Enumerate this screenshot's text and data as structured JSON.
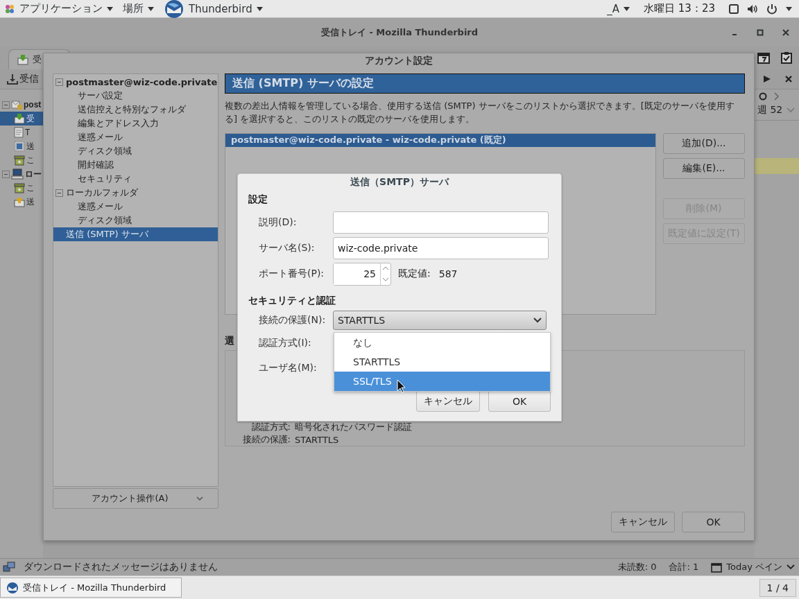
{
  "top_bar": {
    "menus": [
      {
        "label": "アプリケーション",
        "kind": "apps"
      },
      {
        "label": "場所",
        "kind": "places"
      },
      {
        "label": "Thunderbird",
        "kind": "app"
      }
    ],
    "input_method": "_A",
    "clock": "水曜日 13：23"
  },
  "main_window": {
    "title": "受信トレイ - Mozilla Thunderbird",
    "tab": "受",
    "get_mail": "受信",
    "folders": [
      {
        "label": "post",
        "kind": "mail-account",
        "expanded": true,
        "selected": false,
        "children": [
          {
            "label": "受",
            "kind": "inbox",
            "selected": true
          },
          {
            "label": "T",
            "kind": "page",
            "selected": false
          },
          {
            "label": "送",
            "kind": "stamp",
            "selected": false
          },
          {
            "label": "こ",
            "kind": "trash",
            "selected": false
          }
        ]
      },
      {
        "label": "ロー",
        "kind": "local",
        "expanded": true,
        "selected": false,
        "children": [
          {
            "label": "こ",
            "kind": "trash",
            "selected": false
          },
          {
            "label": "送",
            "kind": "outbox",
            "selected": false
          }
        ]
      }
    ],
    "today_pane": {
      "week": "週 52"
    },
    "status_bar": {
      "message": "ダウンロードされたメッセージはありません",
      "unread": "未読数: 0",
      "total": "合計: 1",
      "today_pane": "Today ペイン"
    }
  },
  "account_dialog": {
    "title": "アカウント設定",
    "tree": [
      {
        "label": "postmaster@wiz-code.private",
        "expanded": true,
        "selected": false,
        "children": [
          {
            "label": "サーバ設定",
            "selected": false
          },
          {
            "label": "送信控えと特別なフォルダ",
            "selected": false
          },
          {
            "label": "編集とアドレス入力",
            "selected": false
          },
          {
            "label": "迷惑メール",
            "selected": false
          },
          {
            "label": "ディスク領域",
            "selected": false
          },
          {
            "label": "開封確認",
            "selected": false
          },
          {
            "label": "セキュリティ",
            "selected": false
          }
        ]
      },
      {
        "label": "ローカルフォルダ",
        "expanded": true,
        "selected": false,
        "children": [
          {
            "label": "迷惑メール",
            "selected": false
          },
          {
            "label": "ディスク領域",
            "selected": false
          }
        ]
      },
      {
        "label": "送信 (SMTP) サーバ",
        "selected": true
      }
    ],
    "account_actions": "アカウント操作(A)",
    "heading": "送信 (SMTP) サーバの設定",
    "description": "複数の差出人情報を管理している場合、使用する送信 (SMTP) サーバをこのリストから選択できます。[既定のサーバを使用する] を選択すると、このリストの既定のサーバを使用します。",
    "servers": [
      {
        "label": "postmaster@wiz-code.private - wiz-code.private (既定)",
        "selected": true
      }
    ],
    "side_buttons": [
      {
        "label": "追加(D)...",
        "disabled": false
      },
      {
        "label": "編集(E)...",
        "disabled": false
      },
      {
        "label": "削除(M)",
        "disabled": true
      },
      {
        "label": "既定値に設定(T)",
        "disabled": true
      }
    ],
    "details_heading": "選",
    "details": [
      {
        "label": "認証方式:",
        "value": "暗号化されたパスワード認証"
      },
      {
        "label": "接続の保護:",
        "value": "STARTTLS"
      }
    ],
    "buttons": [
      "キャンセル",
      "OK"
    ]
  },
  "smtp_dialog": {
    "title": "送信（SMTP）サーバ",
    "settings_heading": "設定",
    "description_label": "説明(D):",
    "server_label": "サーバ名(S):",
    "server_name": "wiz-code.private",
    "port_label": "ポート番号(P):",
    "port": "25",
    "default_label": "既定値:",
    "default_port": "587",
    "security_heading": "セキュリティと認証",
    "connection_label": "接続の保護(N):",
    "connection_value": "STARTTLS",
    "connection_options": [
      {
        "label": "なし",
        "selected": false
      },
      {
        "label": "STARTTLS",
        "selected": false
      },
      {
        "label": "SSL/TLS",
        "selected": true
      }
    ],
    "auth_label": "認証方式(I):",
    "username_label": "ユーザ名(M):",
    "buttons": [
      "キャンセル",
      "OK"
    ]
  },
  "taskbar": {
    "window_button": "受信トレイ - Mozilla Thunderbird",
    "workspace": "1 / 4"
  }
}
